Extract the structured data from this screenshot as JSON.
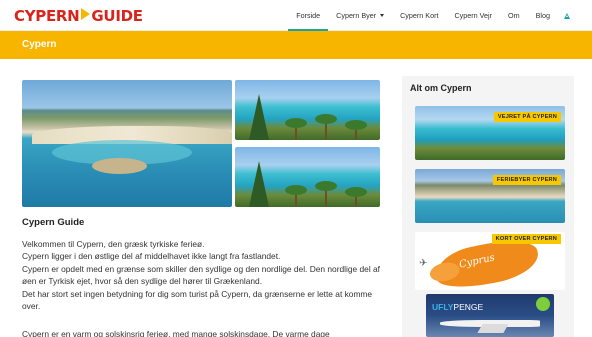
{
  "header": {
    "logo_left": "CYPERN",
    "logo_right": "GUIDE",
    "nav": [
      {
        "label": "Forside",
        "active": true
      },
      {
        "label": "Cypern Byer",
        "dropdown": true
      },
      {
        "label": "Cypern Kort"
      },
      {
        "label": "Cypern Vejr"
      },
      {
        "label": "Om"
      },
      {
        "label": "Blog"
      }
    ],
    "nav_icon": "triangle-icon"
  },
  "banner": {
    "title": "Cypern"
  },
  "main": {
    "heading": "Cypern Guide",
    "lines": [
      "Velkommen til Cypern, den græsk tyrkiske ferieø.",
      "Cypern ligger i den østlige del af middelhavet ikke langt fra fastlandet.",
      "Cypern er opdelt med en grænse som skiller den sydlige og den nordlige del. Den nordlige del af øen er Tyrkisk ejet, hvor så den sydlige del hører til Grækenland.",
      "Det har stort set ingen betydning for dig som turist på Cypern, da grænserne er lette at komme over."
    ],
    "cutoff_line": "Cypern er en varm og solskinsrig ferieø, med mange solskinsdage. De varme dage"
  },
  "sidebar": {
    "title": "Alt om Cypern",
    "cards": [
      {
        "tag": "VEJRET PÅ CYPERN"
      },
      {
        "tag": "FERIEBYER CYPERN"
      },
      {
        "tag": "KORT OVER CYPERN",
        "map_text": "Cyprus"
      },
      {
        "brand_a": "UFLY",
        "brand_b": "PENGE"
      }
    ]
  },
  "colors": {
    "brand_red": "#d7241c",
    "banner_yellow": "#f7b500",
    "accent_teal": "#1da3a0",
    "tag_yellow": "#f7c800"
  }
}
